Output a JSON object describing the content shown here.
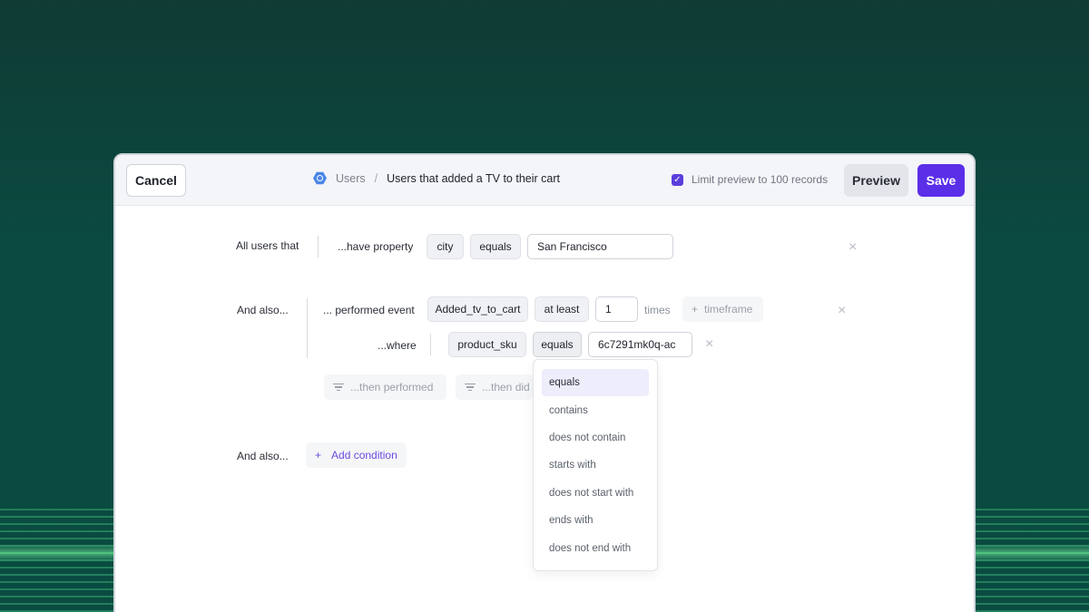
{
  "topbar": {
    "cancel_label": "Cancel",
    "breadcrumb_root": "Users",
    "breadcrumb_separator": "/",
    "breadcrumb_current": "Users that added a TV to their cart",
    "limit_label": "Limit preview to 100 records",
    "limit_checked": true,
    "preview_label": "Preview",
    "save_label": "Save"
  },
  "condition1": {
    "prefix": "All users that",
    "verb": "...have property",
    "property": "city",
    "operator": "equals",
    "value": "San Francisco"
  },
  "condition2": {
    "prefix": "And also...",
    "verb": "... performed event",
    "event": "Added_tv_to_cart",
    "comparator": "at least",
    "count": "1",
    "count_unit": "times",
    "timeframe_label": "timeframe",
    "where_label": "...where",
    "where_property": "product_sku",
    "where_operator": "equals",
    "where_value": "6c7291mk0q-ac",
    "then_performed_label": "...then performed",
    "then_did_label": "...then did"
  },
  "operator_dropdown": {
    "options": [
      "equals",
      "contains",
      "does not contain",
      "starts with",
      "does not start with",
      "ends with",
      "does not end with"
    ],
    "selected": "equals"
  },
  "condition3": {
    "prefix": "And also...",
    "add_label": "Add condition"
  },
  "colors": {
    "accent": "#5b2ee8",
    "background": "#0b4a41"
  }
}
